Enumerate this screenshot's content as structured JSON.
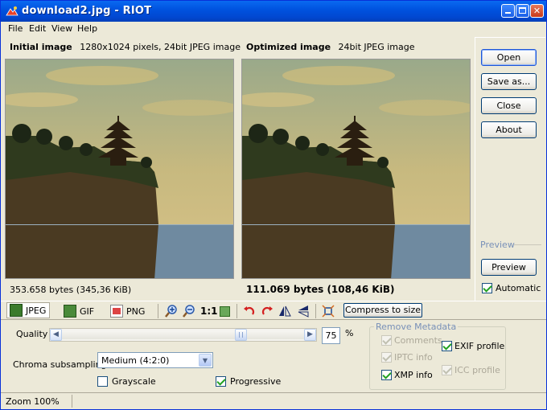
{
  "window": {
    "title": "download2.jpg - RIOT"
  },
  "menu": {
    "file": "File",
    "edit": "Edit",
    "view": "View",
    "help": "Help"
  },
  "initial": {
    "label": "Initial image",
    "info": "1280x1024 pixels, 24bit JPEG image",
    "size": "353.658 bytes (345,36 KiB)"
  },
  "optimized": {
    "label": "Optimized image",
    "info": "24bit JPEG image",
    "size": "111.069 bytes (108,46 KiB)"
  },
  "sidebar": {
    "open": "Open",
    "save": "Save as...",
    "close": "Close",
    "about": "About",
    "preview_group": "Preview",
    "preview_btn": "Preview",
    "automatic": "Automatic"
  },
  "toolbar": {
    "jpeg": "JPEG",
    "gif": "GIF",
    "png": "PNG",
    "one_to_one": "1:1",
    "compress": "Compress to size"
  },
  "options": {
    "quality_label": "Quality",
    "quality_value": "75",
    "quality_unit": "%",
    "quality_level": 0.75,
    "chroma_label": "Chroma subsampling",
    "chroma_value": "Medium (4:2:0)",
    "grayscale": "Grayscale",
    "progressive": "Progressive"
  },
  "metadata": {
    "group": "Remove Metadata",
    "comments": "Comments",
    "iptc": "IPTC info",
    "xmp": "XMP info",
    "exif": "EXIF profile",
    "icc": "ICC profile"
  },
  "status": {
    "zoom": "Zoom 100%"
  },
  "colors": {
    "titlebar": "#0053e0",
    "face": "#ece9d8",
    "sky": "#c9b780",
    "sea": "#6e8da6"
  }
}
